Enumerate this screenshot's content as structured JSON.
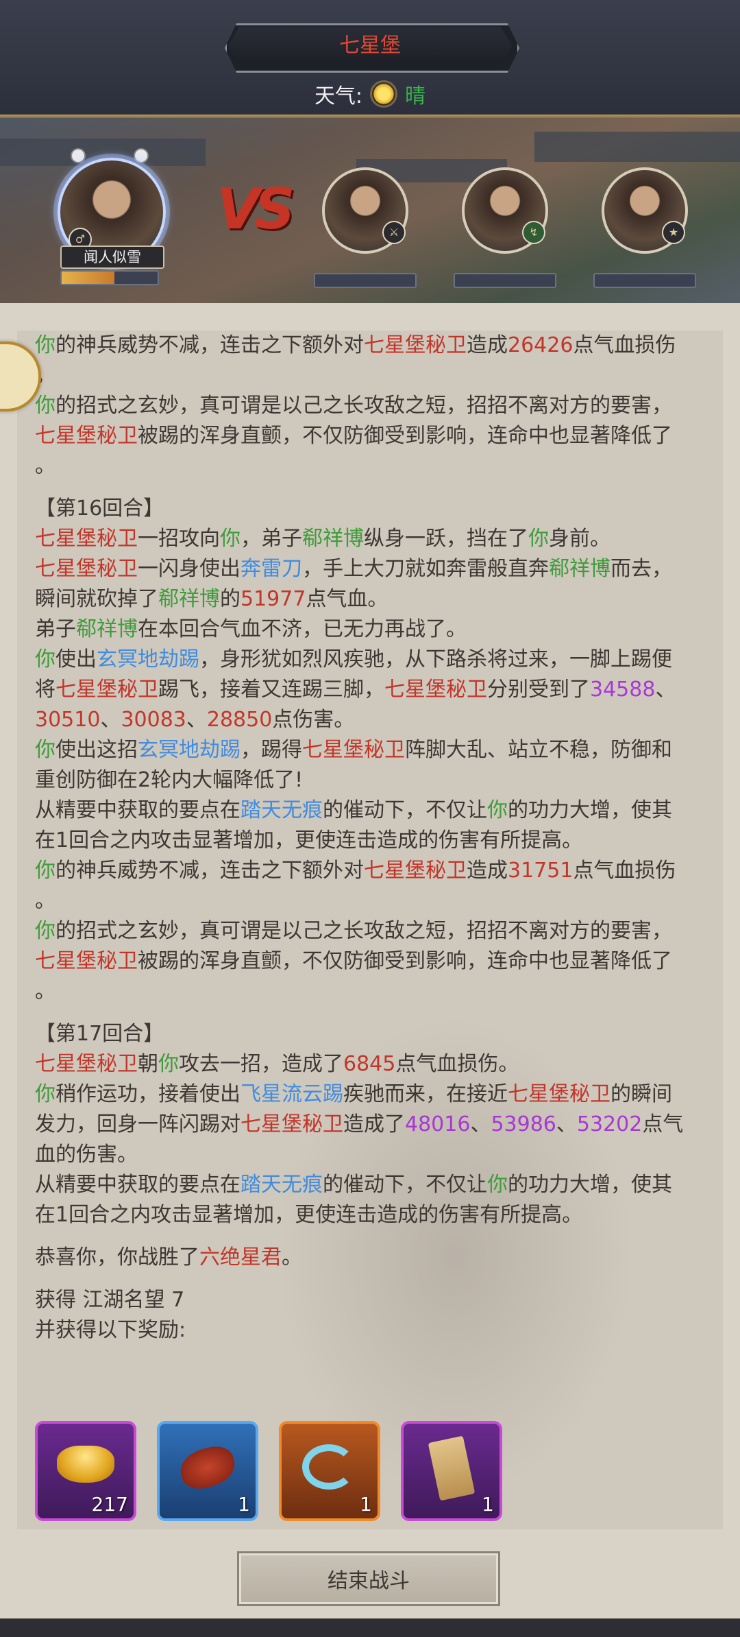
{
  "header": {
    "location": "七星堡",
    "weather_label": "天气:",
    "weather_value": "晴",
    "weather_icon": "sun-icon"
  },
  "battle": {
    "player_name": "闻人似雪",
    "vs_text": "VS",
    "player_hp_fraction": 0.55,
    "enemy_count": 3
  },
  "log": [
    {
      "type": "line",
      "spans": [
        [
          "g",
          "你"
        ],
        [
          "",
          "的神兵威势不减，连击之下额外对"
        ],
        [
          "r",
          "七星堡秘卫"
        ],
        [
          "",
          "造成"
        ],
        [
          "r",
          "26426"
        ],
        [
          "",
          "点气血损伤"
        ]
      ]
    },
    {
      "type": "line",
      "spans": [
        [
          "",
          "。"
        ]
      ]
    },
    {
      "type": "line",
      "spans": [
        [
          "g",
          "你"
        ],
        [
          "",
          "的招式之玄妙，真可谓是以己之长攻敌之短，招招不离对方的要害，"
        ]
      ]
    },
    {
      "type": "line",
      "spans": [
        [
          "r",
          "七星堡秘卫"
        ],
        [
          "",
          "被踢的浑身直颤，不仅防御受到影响，连命中也显著降低了"
        ]
      ]
    },
    {
      "type": "line",
      "spans": [
        [
          "",
          "。"
        ]
      ]
    },
    {
      "type": "round",
      "spans": [
        [
          "",
          "【第16回合】"
        ]
      ]
    },
    {
      "type": "line",
      "spans": [
        [
          "r",
          "七星堡秘卫"
        ],
        [
          "",
          "一招攻向"
        ],
        [
          "g",
          "你"
        ],
        [
          "",
          "，弟子"
        ],
        [
          "g",
          "郗祥博"
        ],
        [
          "",
          "纵身一跃，挡在了"
        ],
        [
          "g",
          "你"
        ],
        [
          "",
          "身前。"
        ]
      ]
    },
    {
      "type": "line",
      "spans": [
        [
          "r",
          "七星堡秘卫"
        ],
        [
          "",
          "一闪身使出"
        ],
        [
          "b",
          "奔雷刀"
        ],
        [
          "",
          "，手上大刀就如奔雷般直奔"
        ],
        [
          "g",
          "郗祥博"
        ],
        [
          "",
          "而去，"
        ]
      ]
    },
    {
      "type": "line",
      "spans": [
        [
          "",
          "瞬间就砍掉了"
        ],
        [
          "g",
          "郗祥博"
        ],
        [
          "",
          "的"
        ],
        [
          "r",
          "51977"
        ],
        [
          "",
          "点气血。"
        ]
      ]
    },
    {
      "type": "line",
      "spans": [
        [
          "",
          "弟子"
        ],
        [
          "g",
          "郗祥博"
        ],
        [
          "",
          "在本回合气血不济，已无力再战了。"
        ]
      ]
    },
    {
      "type": "line",
      "spans": [
        [
          "g",
          "你"
        ],
        [
          "",
          "使出"
        ],
        [
          "b",
          "玄冥地劫踢"
        ],
        [
          "",
          "，身形犹如烈风疾驰，从下路杀将过来，一脚上踢便"
        ]
      ]
    },
    {
      "type": "line",
      "spans": [
        [
          "",
          "将"
        ],
        [
          "r",
          "七星堡秘卫"
        ],
        [
          "",
          "踢飞，接着又连踢三脚，"
        ],
        [
          "r",
          "七星堡秘卫"
        ],
        [
          "",
          "分别受到了"
        ],
        [
          "p",
          "34588"
        ],
        [
          "",
          "、"
        ]
      ]
    },
    {
      "type": "line",
      "spans": [
        [
          "r",
          "30510"
        ],
        [
          "",
          "、"
        ],
        [
          "r",
          "30083"
        ],
        [
          "",
          "、"
        ],
        [
          "r",
          "28850"
        ],
        [
          "",
          "点伤害。"
        ]
      ]
    },
    {
      "type": "line",
      "spans": [
        [
          "g",
          "你"
        ],
        [
          "",
          "使出这招"
        ],
        [
          "b",
          "玄冥地劫踢"
        ],
        [
          "",
          "，踢得"
        ],
        [
          "r",
          "七星堡秘卫"
        ],
        [
          "",
          "阵脚大乱、站立不稳，防御和"
        ]
      ]
    },
    {
      "type": "line",
      "spans": [
        [
          "",
          "重创防御在2轮内大幅降低了!"
        ]
      ]
    },
    {
      "type": "line",
      "spans": [
        [
          "",
          "从精要中获取的要点在"
        ],
        [
          "b",
          "踏天无痕"
        ],
        [
          "",
          "的催动下，不仅让"
        ],
        [
          "g",
          "你"
        ],
        [
          "",
          "的功力大增，使其"
        ]
      ]
    },
    {
      "type": "line",
      "spans": [
        [
          "",
          "在1回合之内攻击显著增加，更使连击造成的伤害有所提高。"
        ]
      ]
    },
    {
      "type": "line",
      "spans": [
        [
          "g",
          "你"
        ],
        [
          "",
          "的神兵威势不减，连击之下额外对"
        ],
        [
          "r",
          "七星堡秘卫"
        ],
        [
          "",
          "造成"
        ],
        [
          "r",
          "31751"
        ],
        [
          "",
          "点气血损伤"
        ]
      ]
    },
    {
      "type": "line",
      "spans": [
        [
          "",
          "。"
        ]
      ]
    },
    {
      "type": "line",
      "spans": [
        [
          "g",
          "你"
        ],
        [
          "",
          "的招式之玄妙，真可谓是以己之长攻敌之短，招招不离对方的要害，"
        ]
      ]
    },
    {
      "type": "line",
      "spans": [
        [
          "r",
          "七星堡秘卫"
        ],
        [
          "",
          "被踢的浑身直颤，不仅防御受到影响，连命中也显著降低了"
        ]
      ]
    },
    {
      "type": "line",
      "spans": [
        [
          "",
          "。"
        ]
      ]
    },
    {
      "type": "round",
      "spans": [
        [
          "",
          "【第17回合】"
        ]
      ]
    },
    {
      "type": "line",
      "spans": [
        [
          "r",
          "七星堡秘卫"
        ],
        [
          "",
          "朝"
        ],
        [
          "g",
          "你"
        ],
        [
          "",
          "攻去一招，造成了"
        ],
        [
          "r",
          "6845"
        ],
        [
          "",
          "点气血损伤。"
        ]
      ]
    },
    {
      "type": "line",
      "spans": [
        [
          "g",
          "你"
        ],
        [
          "",
          "稍作运功，接着使出"
        ],
        [
          "b",
          "飞星流云踢"
        ],
        [
          "",
          "疾驰而来，在接近"
        ],
        [
          "r",
          "七星堡秘卫"
        ],
        [
          "",
          "的瞬间"
        ]
      ]
    },
    {
      "type": "line",
      "spans": [
        [
          "",
          "发力，回身一阵闪踢对"
        ],
        [
          "r",
          "七星堡秘卫"
        ],
        [
          "",
          "造成了"
        ],
        [
          "p",
          "48016"
        ],
        [
          "",
          "、"
        ],
        [
          "p",
          "53986"
        ],
        [
          "",
          "、"
        ],
        [
          "p",
          "53202"
        ],
        [
          "",
          "点气"
        ]
      ]
    },
    {
      "type": "line",
      "spans": [
        [
          "",
          "血的伤害。"
        ]
      ]
    },
    {
      "type": "line",
      "spans": [
        [
          "",
          "从精要中获取的要点在"
        ],
        [
          "b",
          "踏天无痕"
        ],
        [
          "",
          "的催动下，不仅让"
        ],
        [
          "g",
          "你"
        ],
        [
          "",
          "的功力大增，使其"
        ]
      ]
    },
    {
      "type": "line",
      "spans": [
        [
          "",
          "在1回合之内攻击显著增加，更使连击造成的伤害有所提高。"
        ]
      ]
    },
    {
      "type": "round",
      "spans": [
        [
          "",
          "恭喜你，你战胜了"
        ],
        [
          "r",
          "六绝星君"
        ],
        [
          "",
          "。"
        ]
      ]
    },
    {
      "type": "round",
      "spans": [
        [
          "",
          "获得 江湖名望 7"
        ]
      ]
    },
    {
      "type": "line",
      "spans": [
        [
          "",
          "并获得以下奖励:"
        ]
      ]
    }
  ],
  "rewards": [
    {
      "icon": "gold-ingot-icon",
      "count": "217",
      "rarity": "purple"
    },
    {
      "icon": "crayfish-icon",
      "count": "1",
      "rarity": "blue"
    },
    {
      "icon": "swirl-icon",
      "count": "1",
      "rarity": "orange"
    },
    {
      "icon": "scroll-envelope-icon",
      "count": "1",
      "rarity": "purple"
    }
  ],
  "footer": {
    "end_button": "结束战斗"
  },
  "colors": {
    "ally_green": "#3e9c3a",
    "enemy_red": "#c2362a",
    "skill_blue": "#3f8ce0",
    "crit_purple": "#a937d6"
  }
}
